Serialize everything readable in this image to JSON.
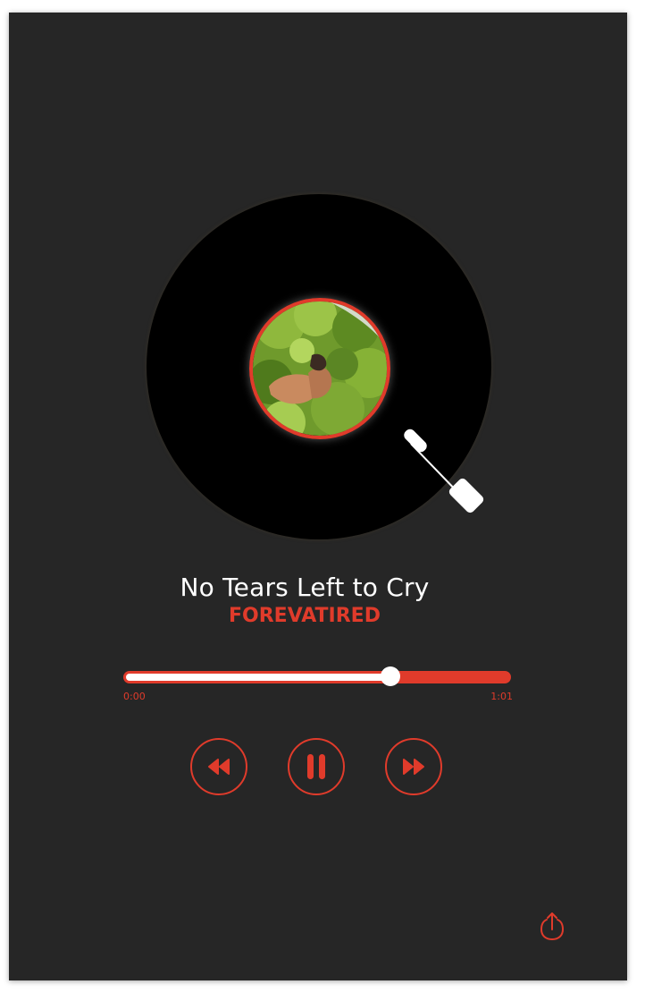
{
  "track": {
    "title": "No Tears Left to Cry",
    "artist": "FOREVATIRED"
  },
  "player": {
    "current_time": "0:00",
    "duration": "1:01",
    "progress_fraction": 0.69,
    "state": "playing"
  },
  "controls": {
    "previous_icon": "rewind-icon",
    "pause_icon": "pause-icon",
    "next_icon": "fast-forward-icon",
    "share_icon": "share-icon"
  },
  "colors": {
    "background": "#262626",
    "accent": "#e03b2b",
    "record": "#000000",
    "text": "#ffffff"
  }
}
